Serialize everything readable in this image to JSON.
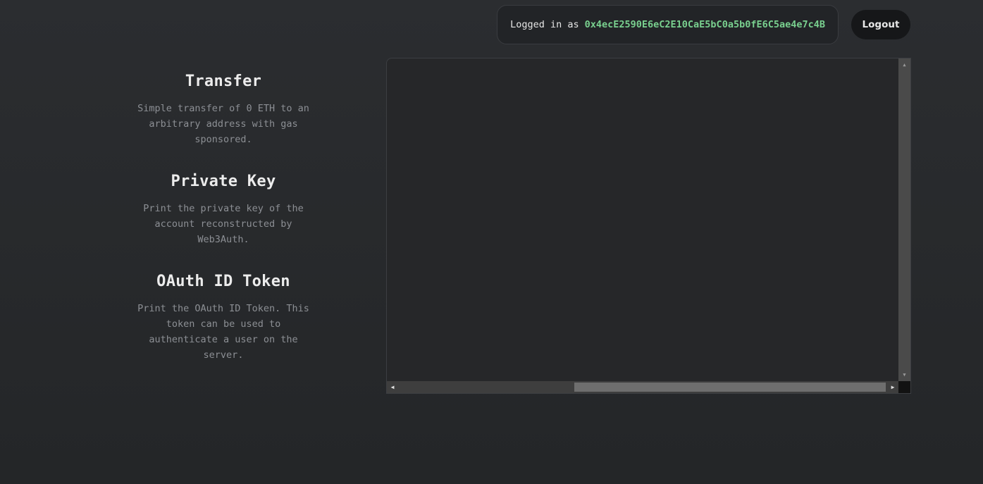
{
  "header": {
    "logged_in_label": "Logged in as",
    "address": "0x4ecE2590E6eC2E10CaE5bC0a5b0fE6C5ae4e7c4B",
    "logout_label": "Logout"
  },
  "actions": [
    {
      "title": "Transfer",
      "description": "Simple transfer of 0 ETH to an arbitrary address with gas sponsored."
    },
    {
      "title": "Private Key",
      "description": "Print the private key of the account reconstructed by Web3Auth."
    },
    {
      "title": "OAuth ID Token",
      "description": "Print the OAuth ID Token. This token can be used to authenticate a user on the server."
    }
  ],
  "console": {
    "output": ""
  },
  "icons": {
    "scroll_up": "triangle-up",
    "scroll_down": "triangle-down",
    "scroll_left": "triangle-left",
    "scroll_right": "triangle-right"
  },
  "colors": {
    "address": "#79d08f",
    "background": "#2a2c2f",
    "panel": "#262729"
  }
}
